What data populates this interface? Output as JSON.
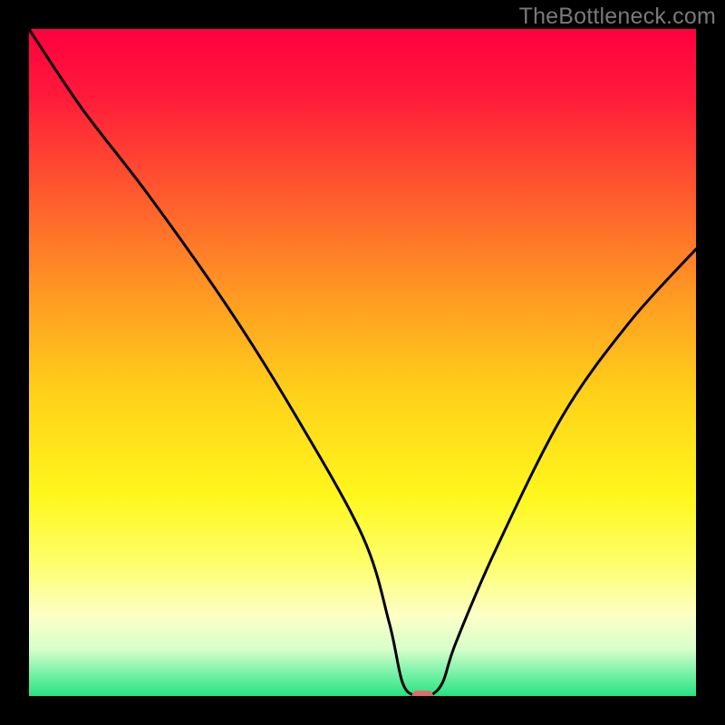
{
  "watermark": "TheBottleneck.com",
  "chart_data": {
    "type": "line",
    "title": "",
    "xlabel": "",
    "ylabel": "",
    "xlim": [
      0,
      100
    ],
    "ylim": [
      0,
      100
    ],
    "grid": false,
    "legend": false,
    "series": [
      {
        "name": "bottleneck-curve",
        "x": [
          0,
          8,
          18,
          30,
          40,
          50,
          54,
          56,
          58,
          60,
          62,
          64,
          70,
          80,
          90,
          100
        ],
        "values": [
          100,
          88,
          75,
          58,
          42,
          24,
          11,
          2,
          0,
          0,
          2,
          8,
          22,
          42,
          56,
          67
        ]
      }
    ],
    "marker": {
      "name": "optimal-marker",
      "x": 59,
      "y": 0,
      "color": "#e46a6a",
      "width": 3.2,
      "height": 1.6
    },
    "background_gradient": {
      "stops": [
        {
          "offset": 0.0,
          "color": "#ff0040"
        },
        {
          "offset": 0.1,
          "color": "#ff1a3a"
        },
        {
          "offset": 0.25,
          "color": "#ff5b2e"
        },
        {
          "offset": 0.4,
          "color": "#ff9a22"
        },
        {
          "offset": 0.55,
          "color": "#ffd21a"
        },
        {
          "offset": 0.7,
          "color": "#fff71c"
        },
        {
          "offset": 0.8,
          "color": "#fdff6a"
        },
        {
          "offset": 0.88,
          "color": "#fdffc6"
        },
        {
          "offset": 0.93,
          "color": "#d7ffca"
        },
        {
          "offset": 0.965,
          "color": "#7af2a8"
        },
        {
          "offset": 1.0,
          "color": "#26e37e"
        }
      ]
    }
  }
}
